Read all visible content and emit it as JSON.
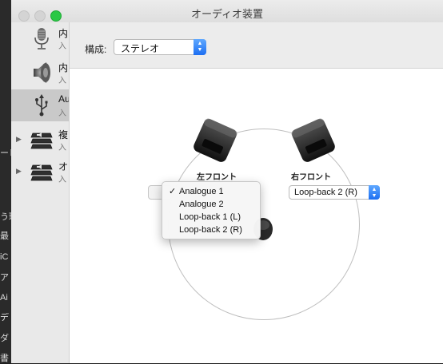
{
  "window": {
    "title": "オーディオ装置"
  },
  "background_app": {
    "visible_fragments": [
      "ーレ",
      "う環",
      "最",
      "iC",
      "ア",
      "Ai",
      "デ",
      "ダ",
      "書"
    ]
  },
  "sidebar": {
    "items": [
      {
        "name": "内",
        "sub": "入",
        "icon": "microphone-icon",
        "expandable": false,
        "selected": false
      },
      {
        "name": "内",
        "sub": "入",
        "icon": "speaker-icon",
        "expandable": false,
        "selected": false
      },
      {
        "name": "Au",
        "sub": "入",
        "icon": "usb-icon",
        "expandable": false,
        "selected": true
      },
      {
        "name": "複",
        "sub": "入",
        "icon": "aggregate-device-icon",
        "expandable": true,
        "selected": false
      },
      {
        "name": "オ",
        "sub": "入",
        "icon": "aggregate-device-icon",
        "expandable": true,
        "selected": false
      }
    ],
    "disclosure_glyph": "▶"
  },
  "config": {
    "label": "構成:",
    "value": "ステレオ"
  },
  "speakers": {
    "left_label": "左フロント",
    "right_label": "右フロント",
    "right_value": "Loop-back 2 (R)"
  },
  "popup_menu": {
    "items": [
      {
        "label": "Analogue 1",
        "checked": true
      },
      {
        "label": "Analogue 2",
        "checked": false
      },
      {
        "label": "Loop-back 1 (L)",
        "checked": false
      },
      {
        "label": "Loop-back 2 (R)",
        "checked": false
      }
    ],
    "check_glyph": "✓"
  },
  "colors": {
    "accent": "#1d6ff2",
    "zoom_button": "#2ac845"
  }
}
